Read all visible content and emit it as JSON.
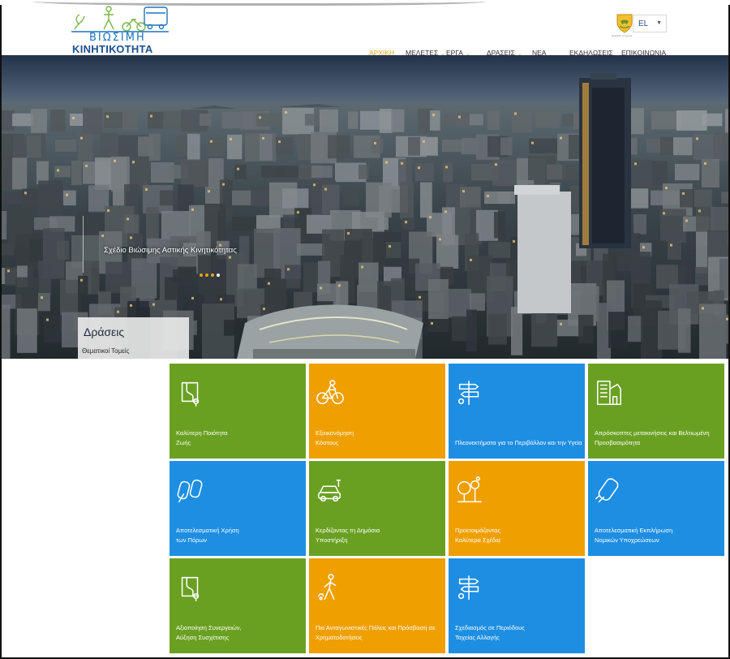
{
  "header": {
    "logo_line1": "ΒΙΩΣΙΜΗ",
    "logo_line2": "ΚΙΝΗΤΙΚΟΤΗΤΑ",
    "emblem_caption": "Republic of Cyprus",
    "language": "EL"
  },
  "nav": [
    {
      "label": "ΑΡΧΙΚΗ",
      "active": true,
      "dropdown": false
    },
    {
      "label": "ΜΕΛΕΤΕΣ",
      "active": false,
      "dropdown": true
    },
    {
      "label": "ΕΡΓΑ",
      "active": false,
      "dropdown": true
    },
    {
      "label": "ΔΡΑΣΕΙΣ",
      "active": false,
      "dropdown": true
    },
    {
      "label": "ΝΕΑ",
      "active": false,
      "dropdown": false
    },
    {
      "label": "ΕΚΔΗΛΩΣΕΙΣ",
      "active": false,
      "dropdown": false
    },
    {
      "label": "ΕΠΙΚΟΙΝΩΝΙΑ",
      "active": false,
      "dropdown": false
    }
  ],
  "hero": {
    "slide_caption": "Σχέδιο Βιώσιμης Αστικής Κινητικότητας",
    "dot_colors": [
      "#e8a317",
      "#e8a317",
      "#e8a317",
      "#ffffff"
    ],
    "box_title": "Δράσεις",
    "box_subtitle": "Θεματικοί Τομείς"
  },
  "colors": {
    "green": "#6aa022",
    "orange": "#ef9f00",
    "blue": "#1e8ee3"
  },
  "tiles": [
    {
      "lines": [
        "Καλύτερη Ποιότητα",
        "Ζωής"
      ],
      "color": "green",
      "icon": "road-map-icon"
    },
    {
      "lines": [
        "Εξοικονόμηση",
        "Κόστους"
      ],
      "color": "orange",
      "icon": "cyclist-icon"
    },
    {
      "lines": [
        "Πλεονεκτήματα για το Περιβάλλον και την Υγεία"
      ],
      "color": "blue",
      "icon": "signpost-icon"
    },
    {
      "lines": [
        "Απρόσκοπτες μετακινήσεις και Βελτιωμένη",
        "Προσβασιμότητα"
      ],
      "color": "green",
      "icon": "buildings-icon"
    },
    {
      "lines": [
        "Αποτελεσματική Χρήση",
        "των Πόρων"
      ],
      "color": "blue",
      "icon": "cars-icon"
    },
    {
      "lines": [
        "Κερδίζοντας τη Δημόσια",
        "Υποστήριξη"
      ],
      "color": "green",
      "icon": "electric-car-icon"
    },
    {
      "lines": [
        "Προετοιμάζοντας",
        "Καλύτερα Σχέδια"
      ],
      "color": "orange",
      "icon": "trees-icon"
    },
    {
      "lines": [
        "Αποτελεσματική Εκπλήρωση",
        "Νομικών Υποχρεώσεων"
      ],
      "color": "blue",
      "icon": "car-icon"
    },
    {
      "lines": [
        "Αξιοποίηση Συνεργειών,",
        "Αύξηση Συσχέτισης"
      ],
      "color": "green",
      "icon": "road-map-icon"
    },
    {
      "lines": [
        "Πιο Ανταγωνιστικές Πόλεις και Πρόσβαση σε",
        "Χρηματοδοτήσεις"
      ],
      "color": "orange",
      "icon": "walker-icon"
    },
    {
      "lines": [
        "Σχεδιασμός σε Περιόδους",
        "Ταχείας Αλλαγής"
      ],
      "color": "blue",
      "icon": "signpost-icon"
    }
  ]
}
